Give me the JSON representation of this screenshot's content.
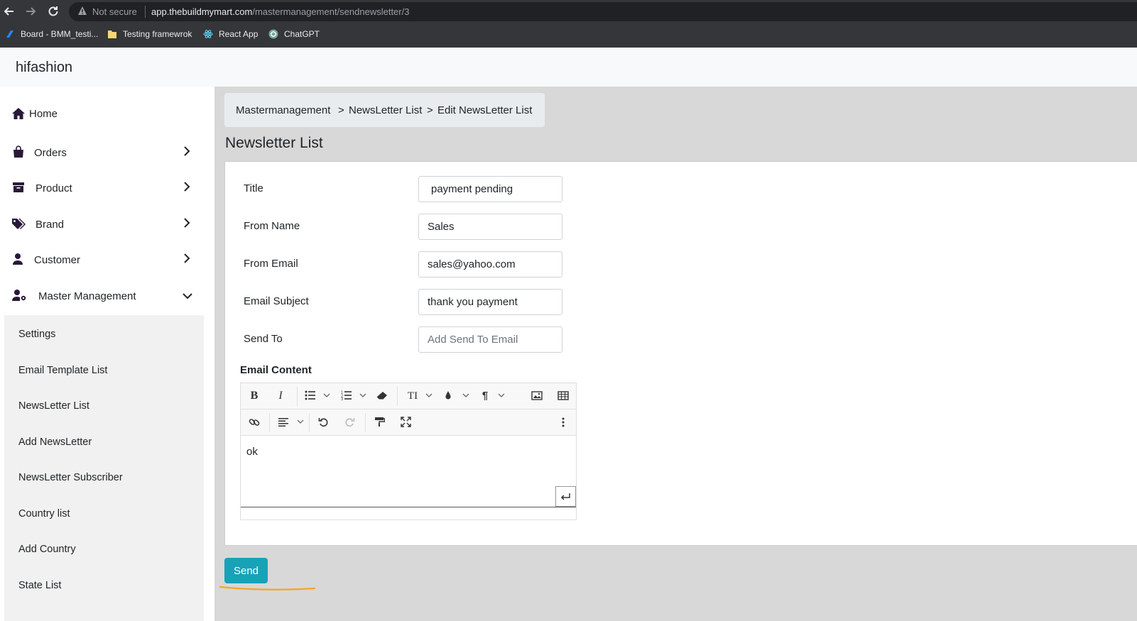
{
  "browser": {
    "security_text": "Not secure",
    "url_host": "app.thebuildmymart.com",
    "url_path": "/mastermanagement/sendnewsletter/3",
    "bookmarks": [
      {
        "label": "Board - BMM_testi..."
      },
      {
        "label": "Testing framewrok"
      },
      {
        "label": "React App"
      },
      {
        "label": "ChatGPT"
      }
    ]
  },
  "header": {
    "brand": "hifashion"
  },
  "sidebar": {
    "items": [
      {
        "label": "Home",
        "icon": "home-icon"
      },
      {
        "label": "Orders",
        "icon": "shopping-bag-icon"
      },
      {
        "label": "Product",
        "icon": "archive-box-icon"
      },
      {
        "label": "Brand",
        "icon": "tags-icon"
      },
      {
        "label": "Customer",
        "icon": "user-icon"
      },
      {
        "label": "Master Management",
        "icon": "user-gear-icon"
      }
    ],
    "submenu": [
      {
        "label": "Settings"
      },
      {
        "label": "Email Template List"
      },
      {
        "label": "NewsLetter List"
      },
      {
        "label": "Add NewsLetter"
      },
      {
        "label": "NewsLetter Subscriber"
      },
      {
        "label": "Country list"
      },
      {
        "label": "Add Country"
      },
      {
        "label": "State List"
      }
    ]
  },
  "breadcrumb": {
    "items": [
      "Mastermanagement",
      "NewsLetter List",
      "Edit NewsLetter List"
    ],
    "separator": ">"
  },
  "page": {
    "title": "Newsletter List"
  },
  "form": {
    "title": {
      "label": "Title",
      "value": "payment pending"
    },
    "from_name": {
      "label": "From Name",
      "value": "Sales"
    },
    "from_email": {
      "label": "From Email",
      "value": "sales@yahoo.com"
    },
    "email_subject": {
      "label": "Email Subject",
      "value": "thank you payment"
    },
    "send_to": {
      "label": "Send To",
      "value": "",
      "placeholder": "Add Send To Email"
    },
    "email_content": {
      "label": "Email Content",
      "value": "ok"
    }
  },
  "editor_toolbar": {
    "bold": "B",
    "italic": "I",
    "font_size": "TI",
    "paragraph": "¶"
  },
  "actions": {
    "send_label": "Send"
  },
  "colors": {
    "primary": "#17a2b8",
    "annotation": "#f5a623",
    "main_bg": "#d8d8d8",
    "sidebar_text_icon": "#2a1838"
  }
}
